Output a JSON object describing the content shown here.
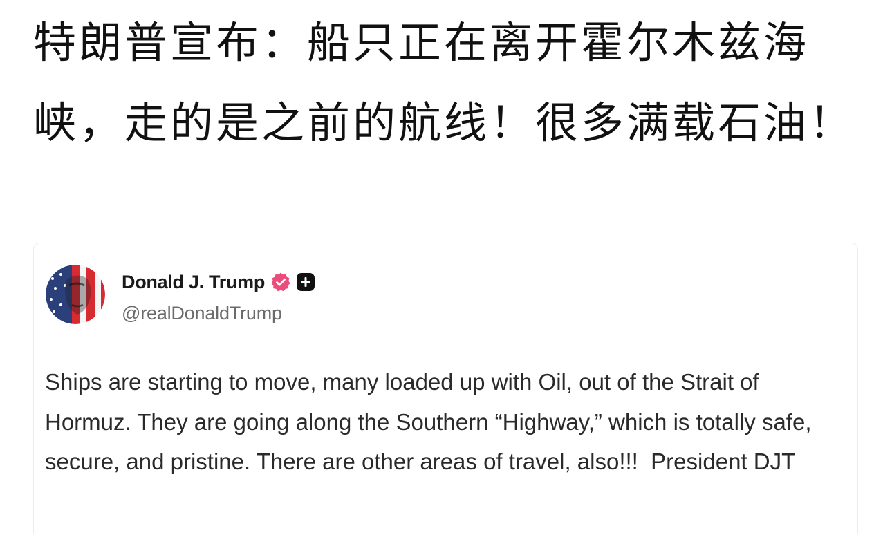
{
  "headline": "特朗普宣布：船只正在离开霍尔木兹海峡，走的是之前的航线！很多满载石油！",
  "post": {
    "author": {
      "name": "Donald J. Trump",
      "handle": "@realDonaldTrump",
      "avatar_icon": "trump-flag-portrait-avatar",
      "verified_icon": "verified-badge-icon",
      "verified_color": "#ee4b7d",
      "plus_icon": "plus-badge-icon",
      "plus_color": "#111111"
    },
    "text": "Ships are starting to move, many loaded up with Oil, out of the Strait of Hormuz. They are going along the Southern “Highway,” which is totally safe, secure, and pristine. There are other areas of travel, also!!!  President DJT"
  }
}
